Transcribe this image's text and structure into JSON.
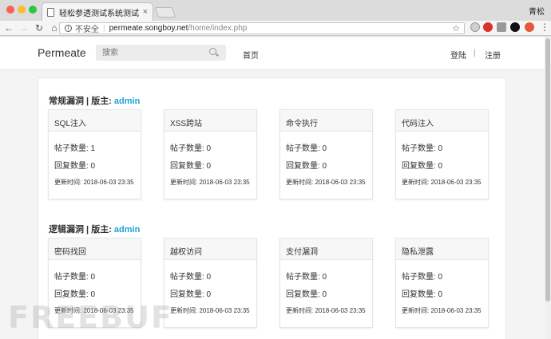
{
  "browser": {
    "tab_title": "轻松参透测试系统测试",
    "tab_close": "×",
    "profile_name": "青松",
    "url_security": "不安全",
    "url_separator": "|",
    "url_host": "permeate.songboy.net",
    "url_path": "/home/index.php",
    "icons": [
      "back-icon",
      "forward-icon",
      "reload-icon",
      "home-icon",
      "info-icon",
      "star-icon",
      "menu-icon"
    ]
  },
  "header": {
    "brand": "Permeate",
    "search_placeholder": "搜索",
    "nav_home": "首页",
    "login": "登陆",
    "divider": "|",
    "register": "注册"
  },
  "sections": [
    {
      "title_prefix": "常规漏洞 | 版主:",
      "moderator": "admin",
      "cards": [
        {
          "title": "SQL注入",
          "posts": "帖子数量: 1",
          "replies": "回复数量: 0",
          "updated": "更新时间: 2018-06-03 23:35"
        },
        {
          "title": "XSS跨站",
          "posts": "帖子数量: 0",
          "replies": "回复数量: 0",
          "updated": "更新时间: 2018-06-03 23:35"
        },
        {
          "title": "命令执行",
          "posts": "帖子数量: 0",
          "replies": "回复数量: 0",
          "updated": "更新时间: 2018-06-03 23:35"
        },
        {
          "title": "代码注入",
          "posts": "帖子数量: 0",
          "replies": "回复数量: 0",
          "updated": "更新时间: 2018-06-03 23:35"
        }
      ]
    },
    {
      "title_prefix": "逻辑漏洞 | 版主:",
      "moderator": "admin",
      "cards": [
        {
          "title": "密码找回",
          "posts": "帖子数量: 0",
          "replies": "回复数量: 0",
          "updated": "更新时间: 2018-06-03 23:35"
        },
        {
          "title": "越权访问",
          "posts": "帖子数量: 0",
          "replies": "回复数量: 0",
          "updated": "更新时间: 2018-06-03 23:35"
        },
        {
          "title": "支付漏洞",
          "posts": "帖子数量: 0",
          "replies": "回复数量: 0",
          "updated": "更新时间: 2018-06-03 23:35"
        },
        {
          "title": "隐私泄露",
          "posts": "帖子数量: 0",
          "replies": "回复数量: 0",
          "updated": "更新时间: 2018-06-03 23:35"
        }
      ]
    }
  ],
  "watermark": "FREEBUF",
  "colors": {
    "accent": "#1fa3d8",
    "page_bg": "#f4f4f4"
  }
}
